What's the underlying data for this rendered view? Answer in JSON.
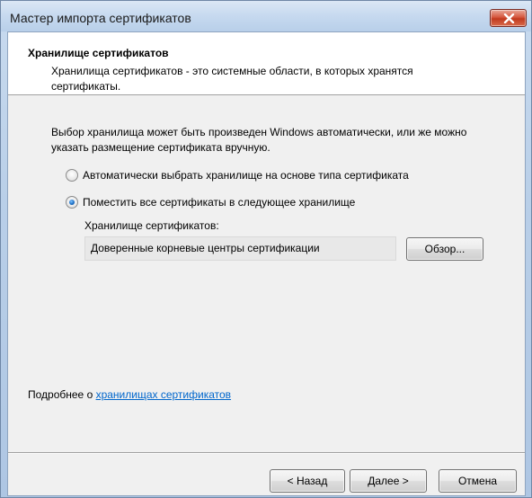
{
  "window": {
    "title": "Мастер импорта сертификатов"
  },
  "header": {
    "title": "Хранилище сертификатов",
    "description": "Хранилища сертификатов - это системные области, в которых хранятся сертификаты."
  },
  "main": {
    "intro": "Выбор хранилища может быть произведен Windows автоматически, или же можно указать размещение сертификата вручную.",
    "options": [
      {
        "label": "Автоматически выбрать хранилище на основе типа сертификата",
        "selected": false
      },
      {
        "label": "Поместить все сертификаты в следующее хранилище",
        "selected": true
      }
    ],
    "store_label": "Хранилище сертификатов:",
    "store_value": "Доверенные корневые центры сертификации",
    "browse_label": "Обзор..."
  },
  "footer": {
    "more_info_prefix": "Подробнее о ",
    "more_info_link": "хранилищах сертификатов",
    "back_label": "< Назад",
    "next_label": "Далее >",
    "cancel_label": "Отмена"
  },
  "icons": {
    "close": "close-icon"
  },
  "colors": {
    "link": "#0066cc",
    "close_button": "#c13a1f",
    "radio_dot": "#1d6fc4"
  }
}
